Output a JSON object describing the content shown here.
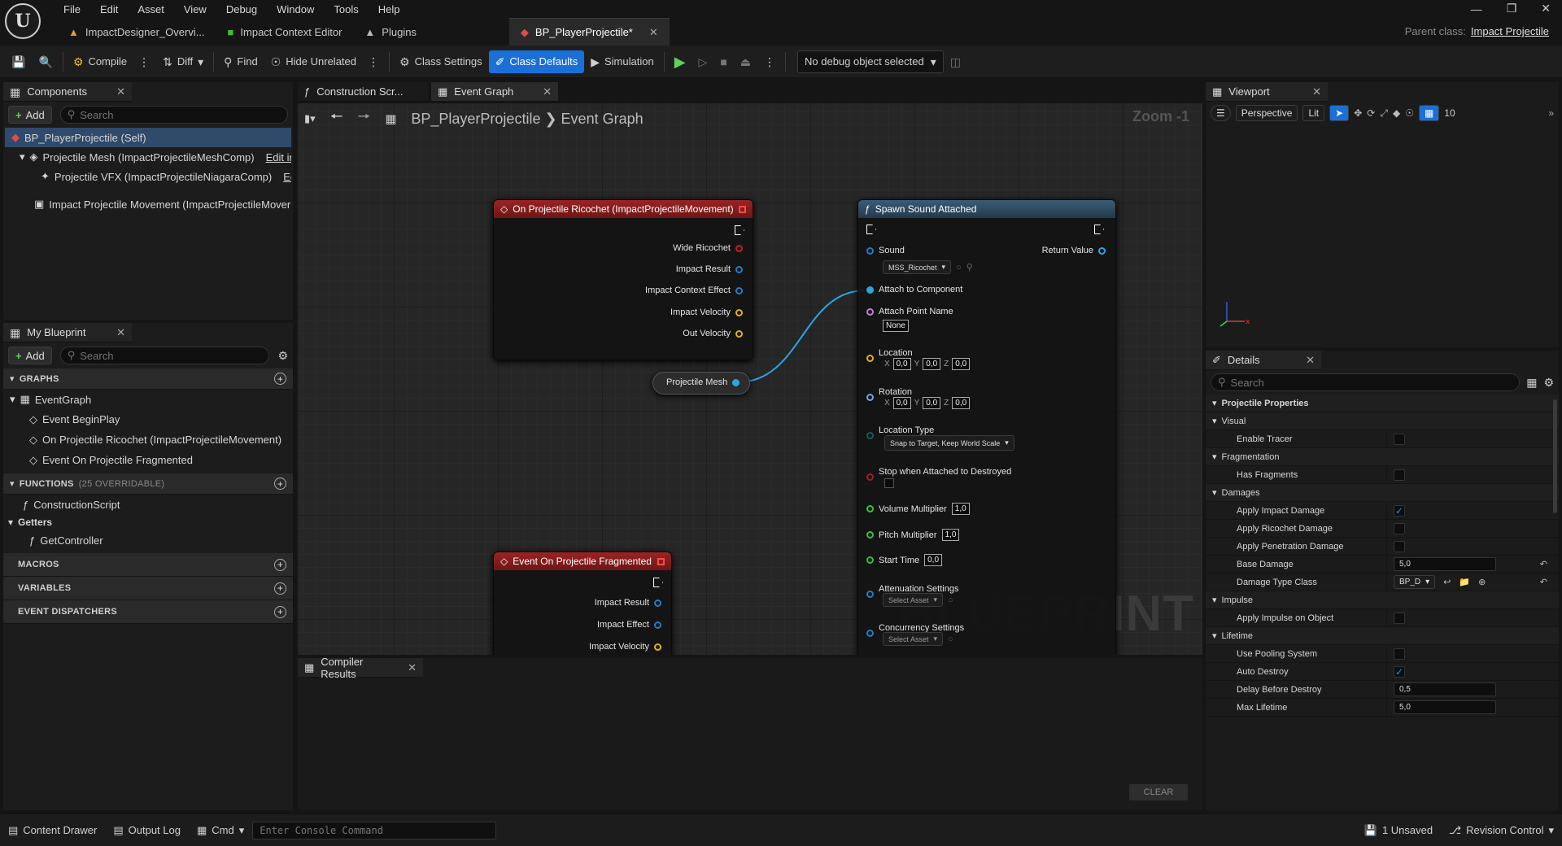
{
  "menu": [
    "File",
    "Edit",
    "Asset",
    "View",
    "Debug",
    "Window",
    "Tools",
    "Help"
  ],
  "doc_tabs": [
    {
      "label": "ImpactDesigner_Overvi...",
      "active": false
    },
    {
      "label": "Impact Context Editor",
      "active": false
    },
    {
      "label": "Plugins",
      "active": false
    },
    {
      "label": "BP_PlayerProjectile*",
      "active": true
    }
  ],
  "parent_class": {
    "label": "Parent class:",
    "value": "Impact Projectile"
  },
  "toolbar": {
    "compile": "Compile",
    "diff": "Diff",
    "find": "Find",
    "hide_unrelated": "Hide Unrelated",
    "class_settings": "Class Settings",
    "class_defaults": "Class Defaults",
    "simulation": "Simulation",
    "debug_select": "No debug object selected"
  },
  "components": {
    "tab": "Components",
    "add": "Add",
    "search_placeholder": "Search",
    "items": [
      "BP_PlayerProjectile (Self)",
      "Projectile Mesh (ImpactProjectileMeshComp)",
      "Projectile VFX (ImpactProjectileNiagaraComp)",
      "Impact Projectile Movement (ImpactProjectileMover"
    ],
    "edit_labels": [
      "Edit ir",
      "Edi"
    ]
  },
  "my_blueprint": {
    "tab": "My Blueprint",
    "add": "Add",
    "search_placeholder": "Search",
    "graphs_header": "GRAPHS",
    "graphs": [
      "EventGraph",
      "Event BeginPlay",
      "On Projectile Ricochet (ImpactProjectileMovement)",
      "Event On Projectile Fragmented"
    ],
    "functions_header": "FUNCTIONS",
    "functions_count": "(25 OVERRIDABLE)",
    "functions": [
      "ConstructionScript"
    ],
    "getters_header": "Getters",
    "getters": [
      "GetController"
    ],
    "macros": "MACROS",
    "variables": "VARIABLES",
    "dispatchers": "EVENT DISPATCHERS"
  },
  "graph_tabs": [
    {
      "label": "Construction Scr..."
    },
    {
      "label": "Event Graph"
    }
  ],
  "breadcrumb": {
    "root": "BP_PlayerProjectile",
    "leaf": "Event Graph"
  },
  "zoom": "Zoom -1",
  "watermark": "BLUEPRINT",
  "nodes": {
    "ricochet": {
      "title": "On Projectile Ricochet (ImpactProjectileMovement)",
      "pins": [
        "Wide Ricochet",
        "Impact Result",
        "Impact Context Effect",
        "Impact Velocity",
        "Out Velocity"
      ]
    },
    "mesh": {
      "label": "Projectile Mesh"
    },
    "fragmented": {
      "title": "Event On Projectile Fragmented",
      "pins": [
        "Impact Result",
        "Impact Effect",
        "Impact Velocity"
      ]
    },
    "spawn": {
      "title": "Spawn Sound Attached",
      "sound_label": "Sound",
      "sound_value": "MSS_Ricochet",
      "return_value": "Return Value",
      "attach_component": "Attach to Component",
      "attach_point": "Attach Point Name",
      "attach_point_value": "None",
      "location": "Location",
      "rotation": "Rotation",
      "vec": [
        "0,0",
        "0,0",
        "0,0"
      ],
      "axes": [
        "X",
        "Y",
        "Z"
      ],
      "location_type": "Location Type",
      "location_type_value": "Snap to Target, Keep World Scale",
      "stop_when": "Stop when Attached to Destroyed",
      "volume": "Volume Multiplier",
      "volume_value": "1,0",
      "pitch": "Pitch Multiplier",
      "pitch_value": "1,0",
      "start": "Start Time",
      "start_value": "0,0",
      "attenuation": "Attenuation Settings",
      "concurrency": "Concurrency Settings",
      "select_asset": "Select Asset"
    }
  },
  "compiler": {
    "tab": "Compiler Results",
    "clear": "CLEAR"
  },
  "viewport": {
    "tab": "Viewport",
    "perspective": "Perspective",
    "lit": "Lit",
    "grid_value": "10"
  },
  "details": {
    "tab": "Details",
    "search_placeholder": "Search",
    "root": "Projectile Properties",
    "sections": [
      {
        "name": "Visual",
        "rows": [
          {
            "label": "Enable Tracer",
            "type": "check",
            "checked": false
          }
        ]
      },
      {
        "name": "Fragmentation",
        "rows": [
          {
            "label": "Has Fragments",
            "type": "check",
            "checked": false
          }
        ]
      },
      {
        "name": "Damages",
        "rows": [
          {
            "label": "Apply Impact Damage",
            "type": "check",
            "checked": true
          },
          {
            "label": "Apply Ricochet Damage",
            "type": "check",
            "checked": false
          },
          {
            "label": "Apply Penetration Damage",
            "type": "check",
            "checked": false
          },
          {
            "label": "Base Damage",
            "type": "num",
            "value": "5,0",
            "reset": true
          },
          {
            "label": "Damage Type Class",
            "type": "class",
            "value": "BP_D",
            "reset": true
          }
        ]
      },
      {
        "name": "Impulse",
        "rows": [
          {
            "label": "Apply Impulse on Object",
            "type": "check",
            "checked": false
          }
        ]
      },
      {
        "name": "Lifetime",
        "rows": [
          {
            "label": "Use Pooling System",
            "type": "check",
            "checked": false
          },
          {
            "label": "Auto Destroy",
            "type": "check",
            "checked": true
          },
          {
            "label": "Delay Before Destroy",
            "type": "num",
            "value": "0,5"
          },
          {
            "label": "Max Lifetime",
            "type": "num",
            "value": "5,0"
          }
        ]
      }
    ]
  },
  "statusbar": {
    "content_drawer": "Content Drawer",
    "output_log": "Output Log",
    "cmd": "Cmd",
    "console_placeholder": "Enter Console Command",
    "unsaved": "1 Unsaved",
    "revision": "Revision Control"
  }
}
